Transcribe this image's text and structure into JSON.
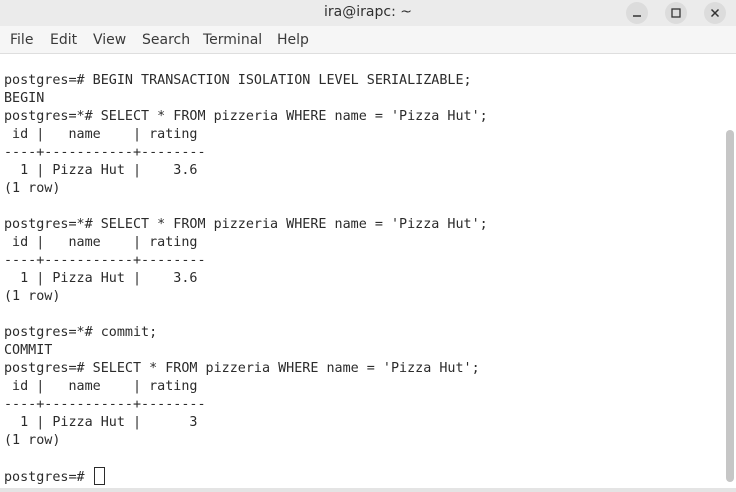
{
  "window": {
    "title": "ira@irapc: ~",
    "controls": {
      "minimize_icon": "minimize-icon",
      "maximize_icon": "maximize-icon",
      "close_icon": "close-icon"
    }
  },
  "menubar": {
    "items": [
      "File",
      "Edit",
      "View",
      "Search",
      "Terminal",
      "Help"
    ]
  },
  "terminal": {
    "lines": [
      "postgres=# BEGIN TRANSACTION ISOLATION LEVEL SERIALIZABLE;",
      "BEGIN",
      "postgres=*# SELECT * FROM pizzeria WHERE name = 'Pizza Hut';",
      " id |   name    | rating",
      "----+-----------+--------",
      "  1 | Pizza Hut |    3.6",
      "(1 row)",
      "",
      "postgres=*# SELECT * FROM pizzeria WHERE name = 'Pizza Hut';",
      " id |   name    | rating",
      "----+-----------+--------",
      "  1 | Pizza Hut |    3.6",
      "(1 row)",
      "",
      "postgres=*# commit;",
      "COMMIT",
      "postgres=# SELECT * FROM pizzeria WHERE name = 'Pizza Hut';",
      " id |   name    | rating",
      "----+-----------+--------",
      "  1 | Pizza Hut |      3",
      "(1 row)",
      ""
    ],
    "prompt": "postgres=# "
  },
  "colors": {
    "background": "#ffffff",
    "text": "#2b2b2b",
    "titlebar": "#ebebeb",
    "menubar": "#f6f6f6"
  }
}
